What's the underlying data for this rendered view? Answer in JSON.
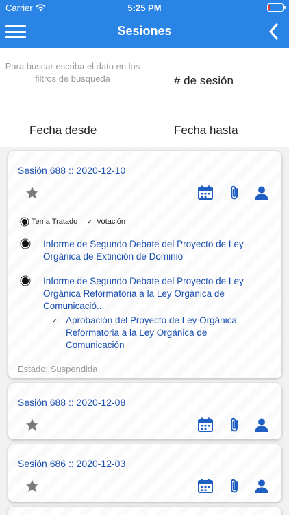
{
  "status_bar": {
    "carrier": "Carrier",
    "time": "5:25 PM",
    "battery_level": 0.1,
    "battery_color": "#e53935"
  },
  "nav": {
    "title": "Sesiones",
    "menu_icon": "hamburger-icon",
    "back_icon": "chevron-left-icon",
    "color": "#2a84e6"
  },
  "filters": {
    "hint": "Para buscar escriba el dato en los filtros de búsqueda",
    "session_number_label": "# de sesión",
    "date_from_label": "Fecha desde",
    "date_to_label": "Fecha hasta"
  },
  "cards": [
    {
      "title": "Sesión 688 :: 2020-12-10",
      "legend": {
        "topic_label": "Tema Tratado",
        "vote_label": "Votación"
      },
      "topics": [
        {
          "text": "Informe de Segundo Debate del Proyecto de Ley Orgánica de Extinción de Dominio"
        },
        {
          "text": "Informe de Segundo Debate del Proyecto de Ley Orgánica Reformatoria a la Ley Orgánica de Comunicació..."
        }
      ],
      "votes": [
        {
          "text": "Aprobación del Proyecto de Ley Orgánica Reformatoria a la Ley Orgánica de Comunicación"
        }
      ],
      "estado": "Estado: Suspendida"
    },
    {
      "title": "Sesión 688 :: 2020-12-08"
    },
    {
      "title": "Sesión 686 :: 2020-12-03"
    }
  ],
  "colors": {
    "accent": "#2a84e6",
    "link": "#1a4fb0",
    "icon": "#1f5fc4",
    "star": "#7a7a7a"
  }
}
